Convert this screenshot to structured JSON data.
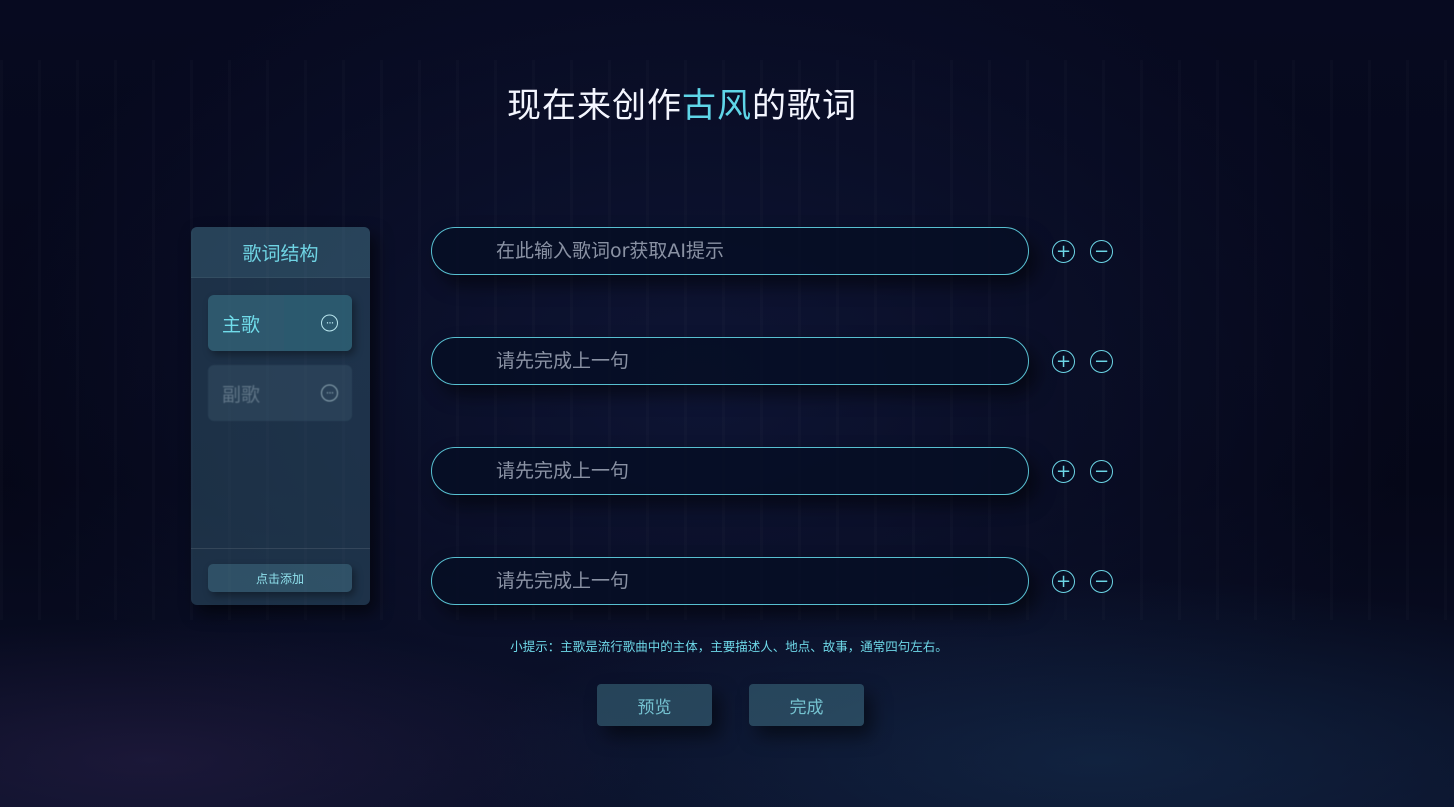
{
  "title": {
    "prefix": "现在来创作",
    "highlight": "古风",
    "suffix": "的歌词"
  },
  "structure_panel": {
    "header": "歌词结构",
    "segments": [
      {
        "label": "主歌",
        "active": true,
        "menu_icon": "ellipsis-circle-icon"
      },
      {
        "label": "副歌",
        "active": false,
        "menu_icon": "ellipsis-circle-icon"
      }
    ],
    "add_label": "点击添加"
  },
  "lyric_lines": [
    {
      "placeholder": "在此输入歌词or获取AI提示",
      "value": ""
    },
    {
      "placeholder": "请先完成上一句",
      "value": ""
    },
    {
      "placeholder": "请先完成上一句",
      "value": ""
    },
    {
      "placeholder": "请先完成上一句",
      "value": ""
    }
  ],
  "line_controls": {
    "add_glyph": "+",
    "remove_glyph": "−"
  },
  "tip": "小提示：主歌是流行歌曲中的主体，主要描述人、地点、故事，通常四句左右。",
  "actions": {
    "preview": "预览",
    "finish": "完成"
  },
  "colors": {
    "accent": "#5fd6e8",
    "background": "#05061a"
  }
}
